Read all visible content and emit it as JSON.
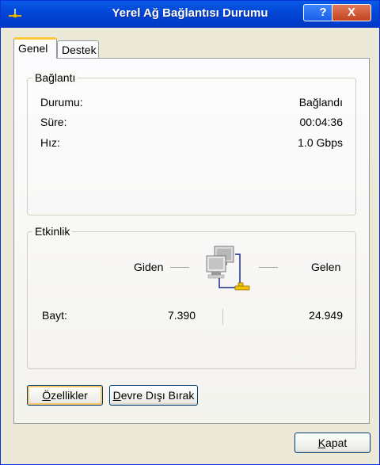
{
  "window": {
    "title": "Yerel Ağ Bağlantısı Durumu",
    "help_glyph": "?",
    "close_glyph": "X"
  },
  "tabs": [
    {
      "label": "Genel"
    },
    {
      "label": "Destek"
    }
  ],
  "connection": {
    "title": "Bağlantı",
    "rows": [
      {
        "label": "Durumu:",
        "value": "Bağlandı"
      },
      {
        "label": "Süre:",
        "value": "00:04:36"
      },
      {
        "label": "Hız:",
        "value": "1.0 Gbps"
      }
    ]
  },
  "activity": {
    "title": "Etkinlik",
    "sent_label": "Giden",
    "received_label": "Gelen",
    "bytes_label": "Bayt:",
    "bytes_sent": "7.390",
    "bytes_received": "24.949"
  },
  "buttons": {
    "properties": {
      "mnemonic": "Ö",
      "rest": "zellikler"
    },
    "disable": {
      "mnemonic": "D",
      "rest": "evre Dışı Bırak"
    },
    "close": {
      "mnemonic": "K",
      "rest": "apat"
    }
  }
}
